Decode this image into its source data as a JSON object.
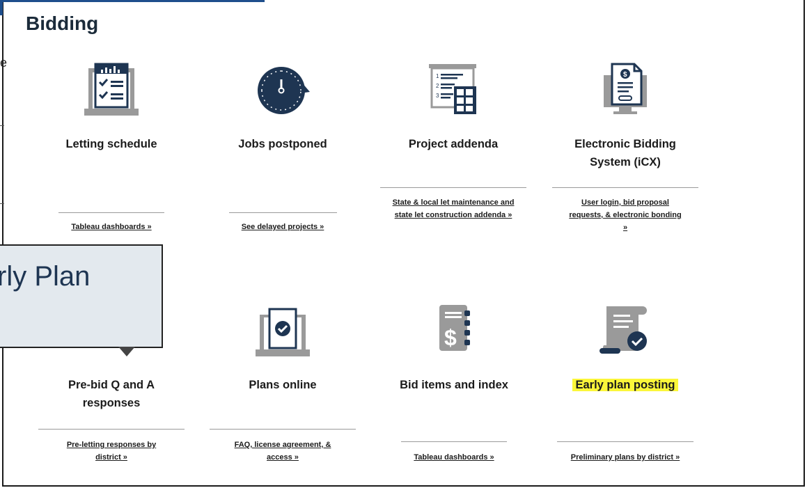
{
  "page": {
    "heading": "Bidding"
  },
  "edge_fragment": "e",
  "callout": {
    "text": "rly Plan"
  },
  "cards": [
    {
      "id": "letting-schedule",
      "title": "Letting schedule",
      "link": "Tableau dashboards »",
      "icon": "letting-schedule-icon"
    },
    {
      "id": "jobs-postponed",
      "title": "Jobs postponed",
      "link": "See delayed projects »",
      "icon": "clock-icon"
    },
    {
      "id": "project-addenda",
      "title": "Project addenda",
      "link": "State & local let maintenance and state let construction addenda »",
      "icon": "addenda-list-icon"
    },
    {
      "id": "ebs",
      "title": "Electronic Bidding System (iCX)",
      "link": "User login, bid proposal requests, & electronic bonding »",
      "icon": "bid-document-monitor-icon"
    },
    {
      "id": "pre-bid-qa",
      "title": "Pre-bid Q and A responses",
      "link": "Pre-letting responses by district »",
      "icon": "chat-bubble-icon"
    },
    {
      "id": "plans-online",
      "title": "Plans online",
      "link": "FAQ, license agreement, & access »",
      "icon": "checked-laptop-icon"
    },
    {
      "id": "bid-items",
      "title": "Bid items and index",
      "link": "Tableau dashboards »",
      "icon": "price-notebook-icon"
    },
    {
      "id": "early-plan",
      "title": "Early plan posting",
      "link": "Preliminary plans by district »",
      "icon": "scroll-check-icon",
      "highlight": "#fbf63a"
    }
  ]
}
